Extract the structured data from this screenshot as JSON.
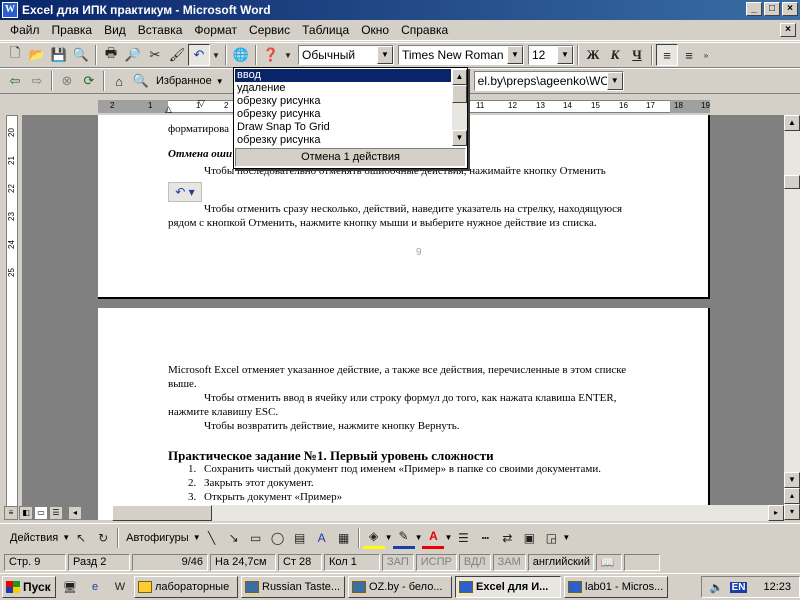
{
  "window": {
    "title": "Excel для ИПК практикум - Microsoft Word"
  },
  "menu": [
    "Файл",
    "Правка",
    "Вид",
    "Вставка",
    "Формат",
    "Сервис",
    "Таблица",
    "Окно",
    "Справка"
  ],
  "toolbar": {
    "style_value": "Обычный",
    "font_value": "Times New Roman",
    "size_value": "12",
    "bold": "Ж",
    "italic": "К",
    "underline": "Ч"
  },
  "webbar": {
    "favorites_label": "Избранное",
    "address_value": "el.by\\preps\\ageenko\\WC"
  },
  "undo_dropdown": {
    "items": [
      "ввод",
      "удаление",
      "обрезку рисунка",
      "обрезку рисунка",
      "Draw Snap To Grid",
      "обрезку рисунка"
    ],
    "status": "Отмена 1 действия"
  },
  "ruler": {
    "ticks": [
      "2",
      "1",
      "1",
      "2",
      "3",
      "11",
      "12",
      "13",
      "14",
      "15",
      "16",
      "17",
      "18",
      "19"
    ],
    "vticks": [
      "20",
      "21",
      "22",
      "23",
      "24",
      "25"
    ]
  },
  "page1": {
    "line_format": "форматирова",
    "heading": "Отмена оши",
    "para1": "Чтобы последовательно отменять ошибочные действия, нажимайте кнопку Отменить",
    "para2a": "Чтобы отменить сразу несколько, действий, наведите указатель на стрелку, находящуюся",
    "para2b": "рядом с кнопкой Отменить, нажмите кнопку мыши и выберите нужное действие из списка.",
    "page_number": "9"
  },
  "page2": {
    "para1a": "Microsoft Excel отменяет указанное действие, а также все действия, перечисленные в этом списке",
    "para1b": "выше.",
    "para2a": "Чтобы отменить ввод в ячейку или строку формул до того, как нажата клавиша ENTER,",
    "para2b": "нажмите клавишу ESC.",
    "para3": "Чтобы возвратить действие, нажмите кнопку Вернуть.",
    "heading": "Практическое задание №1. Первый уровень сложности",
    "list": [
      {
        "num": "1.",
        "text": "Сохранить чистый документ под именем «Пример» в папке со своими документами."
      },
      {
        "num": "2.",
        "text": "Закрыть этот документ."
      },
      {
        "num": "3.",
        "text": "Открыть документ «Пример»"
      }
    ]
  },
  "drawbar": {
    "actions_label": "Действия",
    "autoshapes_label": "Автофигуры"
  },
  "status": {
    "page": "Стр. 9",
    "section": "Разд 2",
    "pages": "9/46",
    "position": "На 24,7см",
    "line": "Ст 28",
    "column": "Кол 1",
    "rec": "ЗАП",
    "trk": "ИСПР",
    "ext": "ВДЛ",
    "ovr": "ЗАМ",
    "language": "английский"
  },
  "taskbar": {
    "start_label": "Пуск",
    "tasks": [
      "лабораторные",
      "Russian Taste...",
      "OZ.by - бело...",
      "Excel для И...",
      "lab01 - Micros..."
    ],
    "kb_layout": "EN",
    "clock": "12:23"
  },
  "colors": {
    "titlebar": "#0a246a",
    "selection": "#0a246a",
    "face": "#d4d0c8"
  }
}
